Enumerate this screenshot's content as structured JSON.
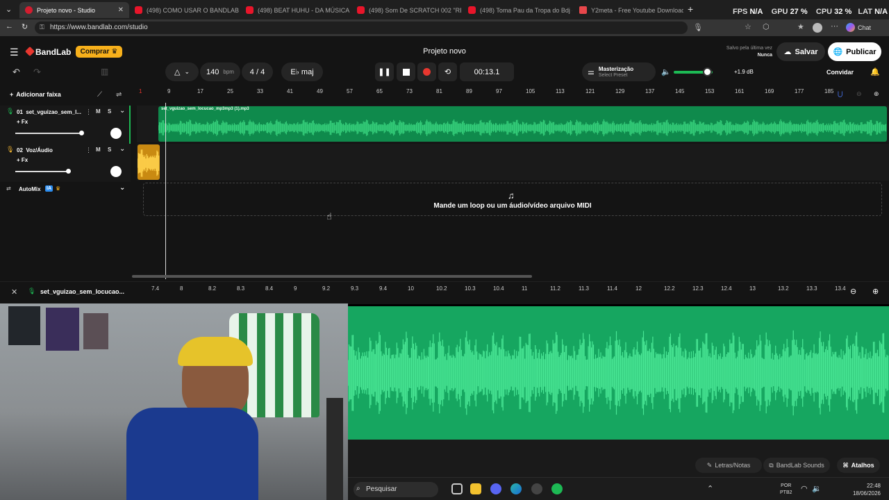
{
  "browser": {
    "tabs": [
      {
        "label": "Projeto novo - Studio",
        "active": true
      },
      {
        "label": "(498) COMO USAR O BANDLAB N",
        "active": false
      },
      {
        "label": "(498) BEAT HUHU - DA MÚSICA E",
        "active": false
      },
      {
        "label": "(498) Som De SCRATCH 002 \"REV",
        "active": false
      },
      {
        "label": "(498) Toma Pau da Tropa do Bdj -",
        "active": false
      },
      {
        "label": "Y2meta - Free Youtube Downloade",
        "active": false
      }
    ],
    "new_tab": "+",
    "url": "https://www.bandlab.com/studio",
    "chat_label": "Chat",
    "overlay": {
      "fps_label": "FPS",
      "fps_value": "N/A",
      "gpu_label": "GPU",
      "gpu_value": "27 %",
      "cpu_label": "CPU",
      "cpu_value": "32 %",
      "lat_label": "LAT",
      "lat_value": "N/A"
    }
  },
  "app": {
    "logo": "BandLab",
    "buy_label": "Comprar",
    "project_title": "Projeto novo",
    "saved_label": "Salvo pela última vez",
    "saved_value": "Nunca",
    "save_label": "Salvar",
    "publish_label": "Publicar",
    "invite_label": "Convidar",
    "accent": "#e8372f",
    "buy_color": "#f7b01b"
  },
  "toolbar": {
    "bpm_value": "140",
    "bpm_unit": "bpm",
    "time_signature": "4 / 4",
    "key": "E♭ maj",
    "time": "00:13.1",
    "mastering_label": "Masterização",
    "mastering_preset": "Select Preset",
    "master_gain": "+1.9 dB"
  },
  "tracks": {
    "add_label": "Adicionar faixa",
    "items": [
      {
        "name": "set_vguizao_sem_l...",
        "fx": "+ Fx",
        "mute": "M",
        "solo": "S",
        "volume": 0.82,
        "color": "#1db954"
      },
      {
        "name": "Voz/Áudio",
        "fx": "+ Fx",
        "mute": "M",
        "solo": "S",
        "volume": 0.66,
        "color": "#f5b731"
      }
    ],
    "automix_label": "AutoMix",
    "automix_badge": "IA",
    "track_numbers": [
      "01",
      "02"
    ]
  },
  "timeline": {
    "ruler": [
      "1",
      "9",
      "17",
      "25",
      "33",
      "41",
      "49",
      "57",
      "65",
      "73",
      "81",
      "89",
      "97",
      "105",
      "113",
      "121",
      "129",
      "137",
      "145",
      "153",
      "161",
      "169",
      "177",
      "185"
    ],
    "clip_label": "set_vguizao_sem_locucao_mp3mp3 (1).mp3",
    "drop_text": "Mande um loop ou um áudio/vídeo arquivo MIDI"
  },
  "editor": {
    "clip_name": "set_vguizao_sem_locucao...",
    "ruler": [
      "7.4",
      "8",
      "8.2",
      "8.3",
      "8.4",
      "9",
      "9.2",
      "9.3",
      "9.4",
      "10",
      "10.2",
      "10.3",
      "10.4",
      "11",
      "11.2",
      "11.3",
      "11.4",
      "12",
      "12.2",
      "12.3",
      "12.4",
      "13",
      "13.2",
      "13.3",
      "13.4"
    ],
    "lyrics_label": "Letras/Notas",
    "sounds_label": "BandLab Sounds",
    "shortcuts_label": "Atalhos"
  },
  "taskbar": {
    "search_label": "Pesquisar",
    "language": "POR",
    "layout": "PTB2",
    "time": "22:48",
    "date": "18/06/2026"
  }
}
